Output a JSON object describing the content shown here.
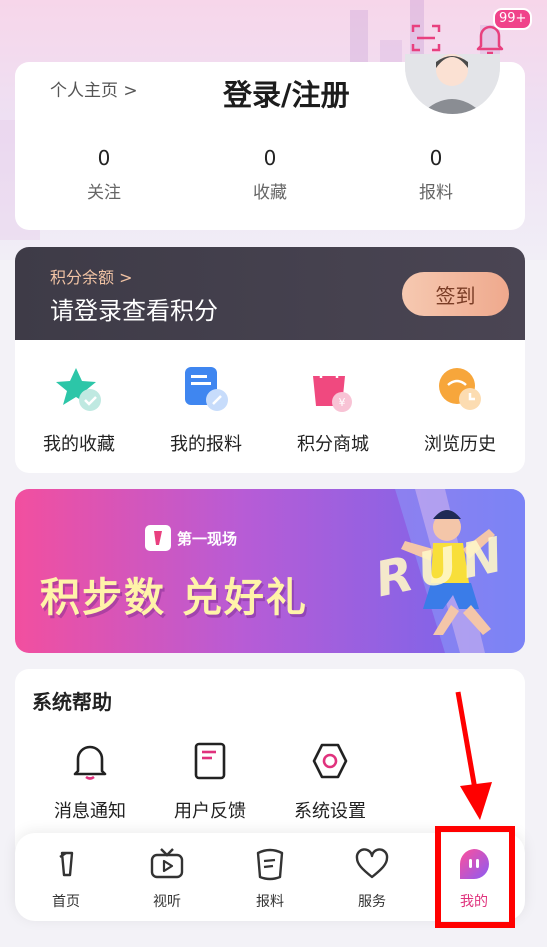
{
  "header": {
    "notification_badge": "99+",
    "icons": [
      "scan-icon",
      "bell-icon"
    ]
  },
  "profile": {
    "home_link": "个人主页 >",
    "login_title": "登录/注册",
    "stats": [
      {
        "value": "0",
        "label": "关注"
      },
      {
        "value": "0",
        "label": "收藏"
      },
      {
        "value": "0",
        "label": "报料"
      }
    ]
  },
  "points": {
    "sub": "积分余额 >",
    "main": "请登录查看积分",
    "signin_label": "签到"
  },
  "quick_links": [
    {
      "label": "我的收藏",
      "icon": "star-icon"
    },
    {
      "label": "我的报料",
      "icon": "report-icon"
    },
    {
      "label": "积分商城",
      "icon": "shopping-bag-icon"
    },
    {
      "label": "浏览历史",
      "icon": "history-icon"
    }
  ],
  "banner": {
    "logo_text": "第一现场",
    "title": "积步数 兑好礼",
    "run_text": "RUN"
  },
  "help": {
    "title": "系统帮助",
    "items": [
      {
        "label": "消息通知",
        "icon": "bell-icon"
      },
      {
        "label": "用户反馈",
        "icon": "feedback-icon"
      },
      {
        "label": "系统设置",
        "icon": "settings-icon"
      }
    ]
  },
  "tabbar": {
    "tabs": [
      {
        "label": "首页",
        "icon": "home-icon"
      },
      {
        "label": "视听",
        "icon": "tv-icon"
      },
      {
        "label": "报料",
        "icon": "report-tab-icon"
      },
      {
        "label": "服务",
        "icon": "heart-icon"
      },
      {
        "label": "我的",
        "icon": "profile-icon",
        "active": true
      }
    ]
  },
  "colors": {
    "accent": "#e0327d",
    "annotation": "#ff0000",
    "points_header": "#3e3b47",
    "signin_button": "#efa98d"
  }
}
